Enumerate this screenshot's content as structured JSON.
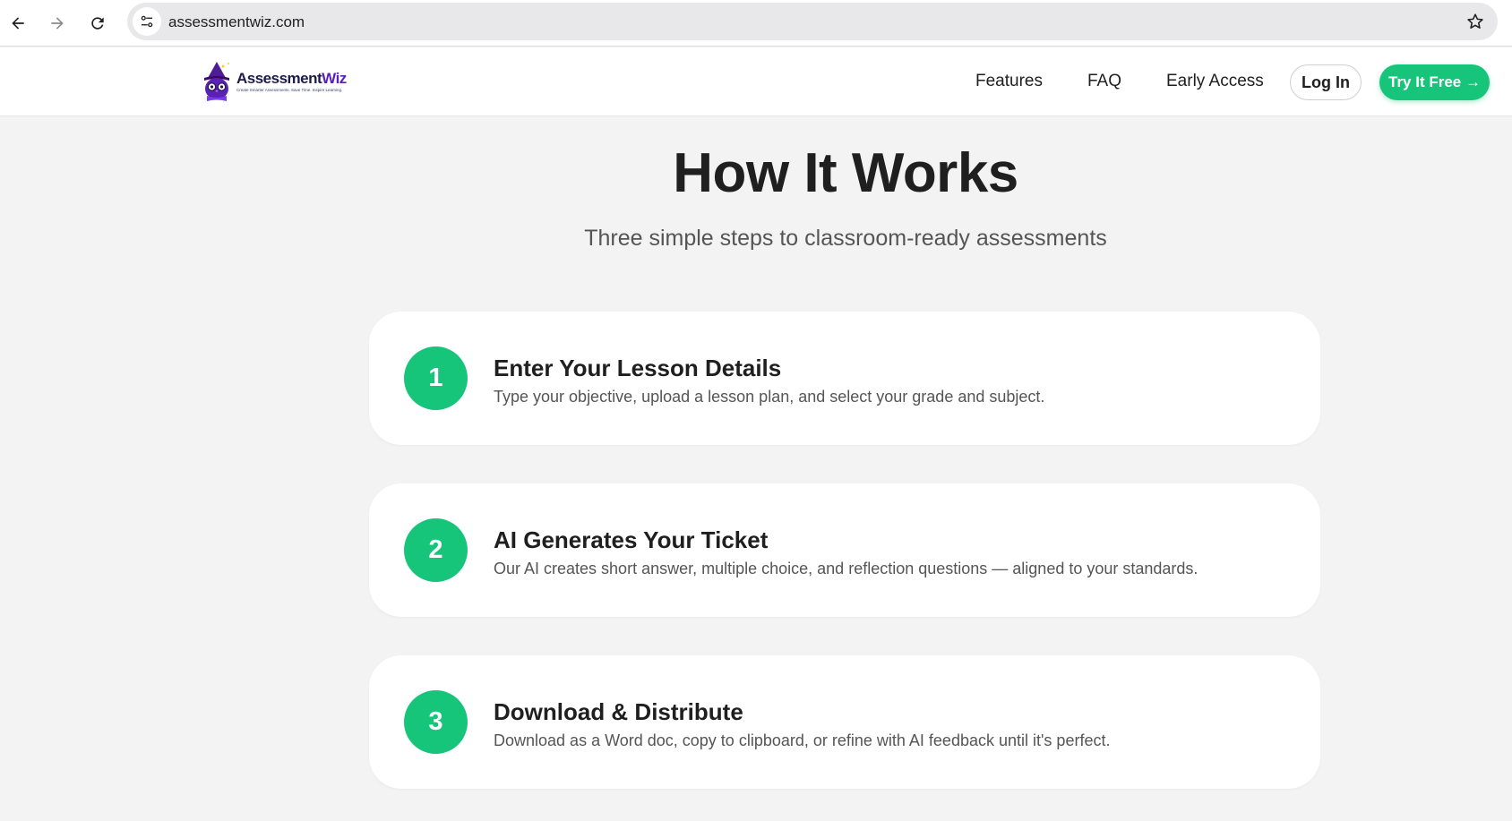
{
  "browser": {
    "url": "assessmentwiz.com"
  },
  "header": {
    "logo_word_main": "Assessment",
    "logo_word_accent": "Wiz",
    "logo_tagline": "Create Smarter Assessments. Save Time. Inspire Learning.",
    "nav": {
      "features": "Features",
      "faq": "FAQ",
      "early_access": "Early Access"
    },
    "login_label": "Log In",
    "try_label": "Try It Free →"
  },
  "main": {
    "title": "How It Works",
    "subtitle": "Three simple steps to classroom-ready assessments",
    "steps": [
      {
        "number": "1",
        "title": "Enter Your Lesson Details",
        "description": "Type your objective, upload a lesson plan, and select your grade and subject."
      },
      {
        "number": "2",
        "title": "AI Generates Your Ticket",
        "description": "Our AI creates short answer, multiple choice, and reflection questions — aligned to your standards."
      },
      {
        "number": "3",
        "title": "Download & Distribute",
        "description": "Download as a Word doc, copy to clipboard, or refine with AI feedback until it's perfect."
      }
    ]
  },
  "colors": {
    "accent_green": "#16c47a",
    "brand_purple": "#5b21b6",
    "page_bg": "#f3f3f3"
  },
  "icons": [
    "back-arrow-icon",
    "forward-arrow-icon",
    "reload-icon",
    "site-info-icon",
    "bookmark-star-icon",
    "wizard-owl-logo-icon"
  ]
}
